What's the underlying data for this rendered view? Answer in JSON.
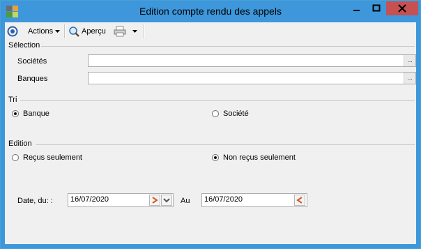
{
  "window": {
    "title": "Edition compte rendu des appels"
  },
  "toolbar": {
    "actions_label": "Actions",
    "preview_label": "Aperçu",
    "icons": [
      "refresh-icon",
      "magnifier-icon",
      "printer-icon"
    ]
  },
  "selection": {
    "title": "Sélection",
    "societes_label": "Sociétés",
    "banques_label": "Banques",
    "societes_value": "",
    "banques_value": "",
    "browse_glyph": "..."
  },
  "tri": {
    "title": "Tri",
    "banque_label": "Banque",
    "societe_label": "Société",
    "selected": "banque"
  },
  "edition": {
    "title": "Edition",
    "recus_label": "Reçus seulement",
    "nonrecus_label": "Non reçus seulement",
    "selected": "nonrecus"
  },
  "dates": {
    "from_label": "Date, du: :",
    "to_label": "Au",
    "from_value": "16/07/2020",
    "to_value": "16/07/2020"
  },
  "colors": {
    "titlebar": "#3d97da",
    "close_button": "#c75050",
    "client_bg": "#f0f0f0",
    "date_arrow": "#d05a20"
  }
}
